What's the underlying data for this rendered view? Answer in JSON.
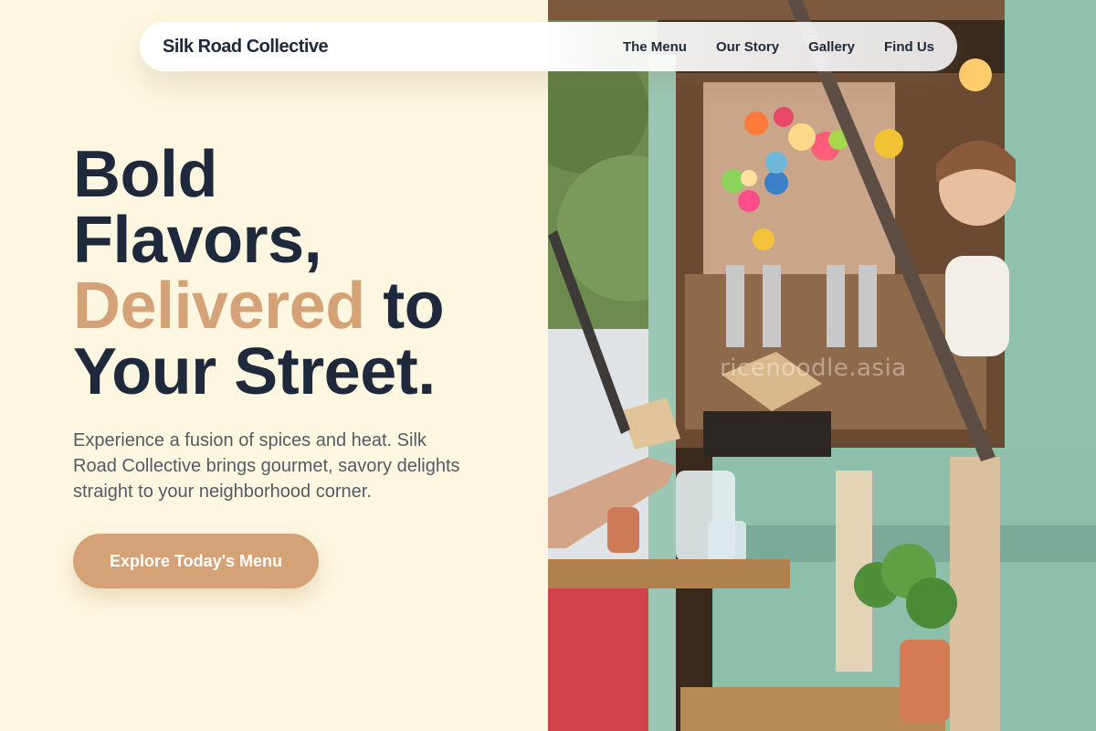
{
  "nav": {
    "brand": "Silk Road Collective",
    "links": [
      "The Menu",
      "Our Story",
      "Gallery",
      "Find Us"
    ]
  },
  "hero": {
    "title_line1": "Bold",
    "title_line2": "Flavors,",
    "title_accent": "Delivered",
    "title_line3_rest": " to",
    "title_line4": "Your Street.",
    "description": "Experience a fusion of spices and heat. Silk Road Collective brings gourmet, savory delights straight to your neighborhood corner.",
    "cta_label": "Explore Today's Menu"
  },
  "photo": {
    "subject": "food truck serving window with string lights, beer taps and a server",
    "watermark": "ricenoodle.asia"
  },
  "colors": {
    "background": "#fdf7e1",
    "text_dark": "#1e293b",
    "accent": "#d4a276",
    "body_text": "#555b66"
  }
}
